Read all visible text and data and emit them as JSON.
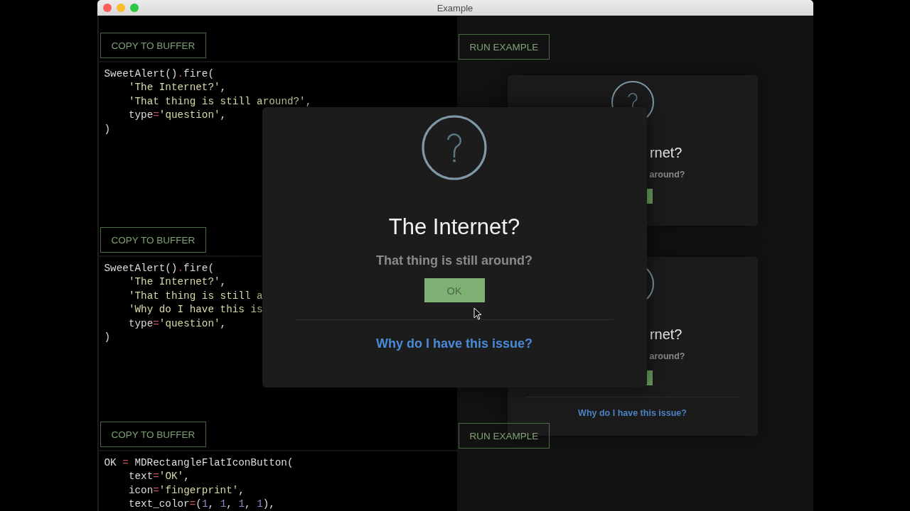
{
  "window": {
    "title": "Example"
  },
  "examples": [
    {
      "copy_button": "COPY TO BUFFER",
      "run_button": "RUN EXAMPLE",
      "code": [
        {
          "indented": false,
          "tokens": [
            {
              "kind": "plain",
              "text": "SweetAlert()"
            },
            {
              "kind": "operator",
              "text": "."
            },
            {
              "kind": "plain",
              "text": "fire("
            }
          ]
        },
        {
          "indented": true,
          "tokens": [
            {
              "kind": "string",
              "text": "'The Internet?'"
            },
            {
              "kind": "plain",
              "text": ","
            }
          ]
        },
        {
          "indented": true,
          "tokens": [
            {
              "kind": "string",
              "text": "'That thing is still around?'"
            },
            {
              "kind": "plain",
              "text": ","
            }
          ]
        },
        {
          "indented": true,
          "tokens": [
            {
              "kind": "plain",
              "text": "type"
            },
            {
              "kind": "operator",
              "text": "="
            },
            {
              "kind": "string",
              "text": "'question'"
            },
            {
              "kind": "plain",
              "text": ","
            }
          ]
        },
        {
          "indented": false,
          "tokens": [
            {
              "kind": "plain",
              "text": ")"
            }
          ]
        }
      ]
    },
    {
      "copy_button": "COPY TO BUFFER",
      "code": [
        {
          "indented": false,
          "tokens": [
            {
              "kind": "plain",
              "text": "SweetAlert()"
            },
            {
              "kind": "operator",
              "text": "."
            },
            {
              "kind": "plain",
              "text": "fire("
            }
          ]
        },
        {
          "indented": true,
          "tokens": [
            {
              "kind": "string",
              "text": "'The Internet?'"
            },
            {
              "kind": "plain",
              "text": ","
            }
          ]
        },
        {
          "indented": true,
          "tokens": [
            {
              "kind": "string",
              "text": "'That thing is still a"
            }
          ]
        },
        {
          "indented": true,
          "tokens": [
            {
              "kind": "string",
              "text": "'Why do I have this is"
            }
          ]
        },
        {
          "indented": true,
          "tokens": [
            {
              "kind": "plain",
              "text": "type"
            },
            {
              "kind": "operator",
              "text": "="
            },
            {
              "kind": "string",
              "text": "'question'"
            },
            {
              "kind": "plain",
              "text": ","
            }
          ]
        },
        {
          "indented": false,
          "tokens": [
            {
              "kind": "plain",
              "text": ")"
            }
          ]
        }
      ]
    },
    {
      "copy_button": "COPY TO BUFFER",
      "run_button": "RUN EXAMPLE",
      "code": [
        {
          "indented": false,
          "tokens": [
            {
              "kind": "plain",
              "text": "OK "
            },
            {
              "kind": "operator",
              "text": "="
            },
            {
              "kind": "plain",
              "text": " MDRectangleFlatIconButton("
            }
          ]
        },
        {
          "indented": true,
          "tokens": [
            {
              "kind": "plain",
              "text": "text"
            },
            {
              "kind": "operator",
              "text": "="
            },
            {
              "kind": "string",
              "text": "'OK'"
            },
            {
              "kind": "plain",
              "text": ","
            }
          ]
        },
        {
          "indented": true,
          "tokens": [
            {
              "kind": "plain",
              "text": "icon"
            },
            {
              "kind": "operator",
              "text": "="
            },
            {
              "kind": "string",
              "text": "'fingerprint'"
            },
            {
              "kind": "plain",
              "text": ","
            }
          ]
        },
        {
          "indented": true,
          "tokens": [
            {
              "kind": "plain",
              "text": "text_color"
            },
            {
              "kind": "operator",
              "text": "="
            },
            {
              "kind": "plain",
              "text": "("
            },
            {
              "kind": "number",
              "text": "1"
            },
            {
              "kind": "plain",
              "text": ", "
            },
            {
              "kind": "number",
              "text": "1"
            },
            {
              "kind": "plain",
              "text": ", "
            },
            {
              "kind": "number",
              "text": "1"
            },
            {
              "kind": "plain",
              "text": ", "
            },
            {
              "kind": "number",
              "text": "1"
            },
            {
              "kind": "plain",
              "text": "),"
            }
          ]
        }
      ]
    }
  ],
  "background_dialogs": [
    {
      "title": "rnet?",
      "text": "around?"
    },
    {
      "title": "rnet?",
      "text": "around?",
      "link": "Why do I have this issue?"
    }
  ],
  "dialog": {
    "title": "The Internet?",
    "text": "That thing is still around?",
    "confirm_button": "OK",
    "link": "Why do I have this issue?"
  }
}
